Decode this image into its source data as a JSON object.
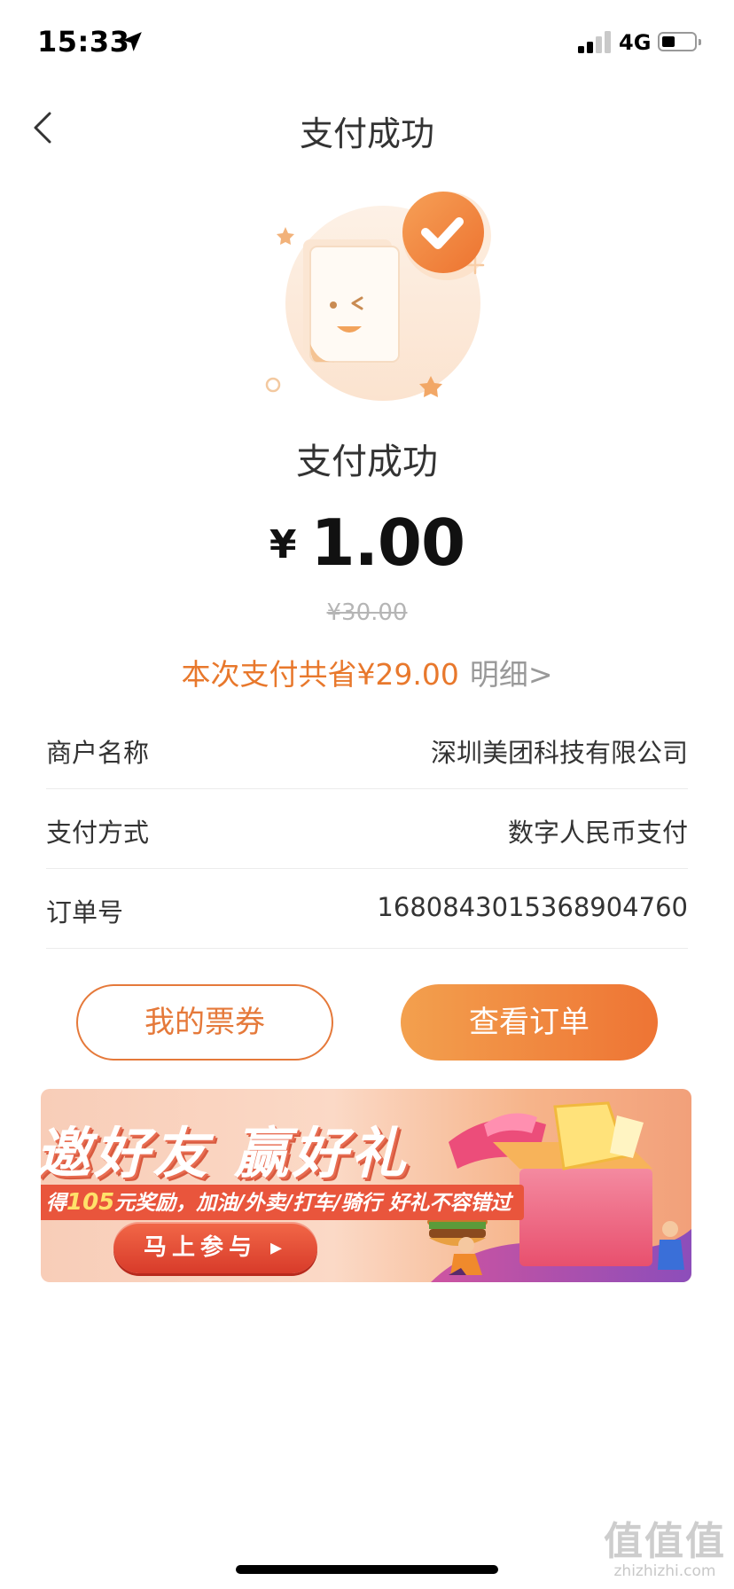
{
  "status_bar": {
    "time": "15:33",
    "network": "4G",
    "battery_level": 0.3
  },
  "nav": {
    "title": "支付成功"
  },
  "result": {
    "title": "支付成功",
    "currency_symbol": "¥",
    "amount": "1.00",
    "original_price": "¥30.00",
    "savings_text": "本次支付共省¥29.00",
    "detail_link": "明细>"
  },
  "info_rows": [
    {
      "label": "商户名称",
      "value": "深圳美团科技有限公司"
    },
    {
      "label": "支付方式",
      "value": "数字人民币支付"
    },
    {
      "label": "订单号",
      "value": "1680843015368904760"
    }
  ],
  "buttons": {
    "my_coupons": "我的票券",
    "view_order": "查看订单"
  },
  "banner": {
    "title": "邀好友 赢好礼",
    "subtitle_prefix": "得",
    "subtitle_amount": "105",
    "subtitle_rest": "元奖励，加油/外卖/打车/骑行  好礼不容错过",
    "cta": "马上参与 ▸"
  },
  "watermark": {
    "mark": "值值值",
    "url": "zhizhizhi.com"
  },
  "colors": {
    "accent": "#e8782c",
    "button_gradient_start": "#f3a04e",
    "button_gradient_end": "#ee7434",
    "banner_red": "#e9553c"
  }
}
